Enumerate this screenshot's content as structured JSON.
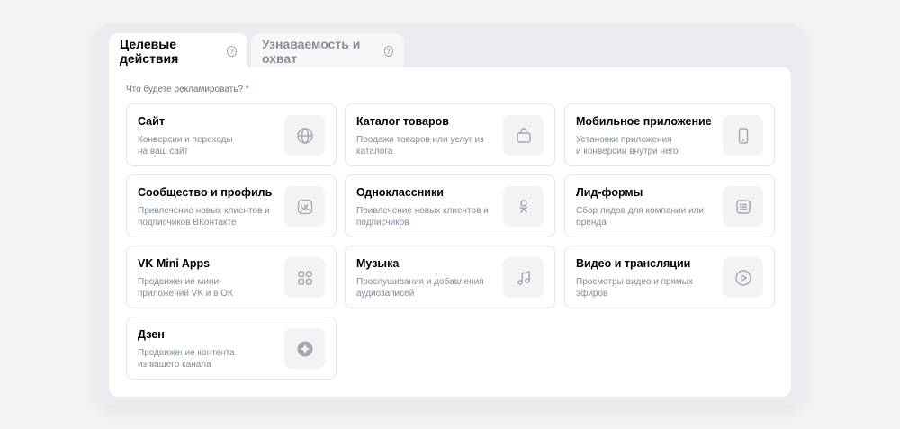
{
  "tabs": [
    {
      "label": "Целевые действия",
      "active": true
    },
    {
      "label": "Узнаваемость и охват",
      "active": false
    }
  ],
  "question": {
    "label": "Что будете рекламировать?",
    "required_mark": "*"
  },
  "cards": [
    {
      "title": "Сайт",
      "desc": "Конверсии и переходы\nна ваш сайт",
      "icon": "globe-icon"
    },
    {
      "title": "Каталог товаров",
      "desc": "Продажи товаров или услуг из\nкаталога",
      "icon": "bag-icon"
    },
    {
      "title": "Мобильное приложение",
      "desc": "Установки приложения\nи конверсии внутри него",
      "icon": "phone-icon"
    },
    {
      "title": "Сообщество и профиль",
      "desc": "Привлечение новых клиентов и\nподписчиков ВКонтакте",
      "icon": "vk-icon"
    },
    {
      "title": "Одноклассники",
      "desc": "Привлечение новых клиентов и\nподписчиков",
      "icon": "odnoklassniki-icon"
    },
    {
      "title": "Лид-формы",
      "desc": "Сбор лидов для компании или\nбренда",
      "icon": "form-icon"
    },
    {
      "title": "VK Mini Apps",
      "desc": "Продвижение мини-\nприложений VK и в ОК",
      "icon": "apps-icon"
    },
    {
      "title": "Музыка",
      "desc": "Прослушивания и добавления\nаудиозаписей",
      "icon": "music-icon"
    },
    {
      "title": "Видео и трансляции",
      "desc": "Просмотры видео и прямых\nэфиров",
      "icon": "play-icon"
    },
    {
      "title": "Дзен",
      "desc": "Продвижение контента\nиз вашего канала",
      "icon": "zen-icon"
    }
  ]
}
